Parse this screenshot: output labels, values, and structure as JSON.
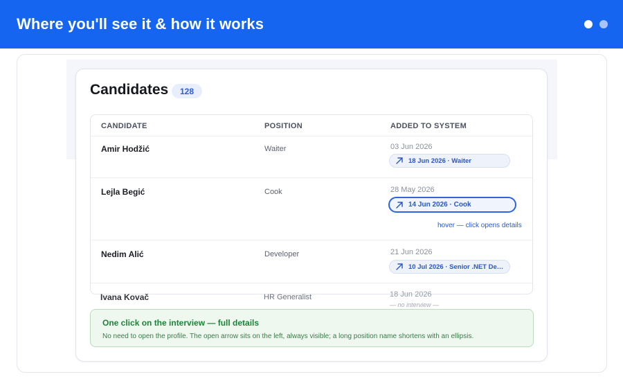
{
  "header": {
    "title": "Where you'll see it & how it works",
    "pager": {
      "count": 2,
      "active_index": 0
    }
  },
  "page": {
    "title": "Candidates",
    "count_badge": "128"
  },
  "table": {
    "columns": [
      "CANDIDATE",
      "POSITION",
      "ADDED TO SYSTEM"
    ],
    "rows": [
      {
        "name": "Amir Hodžić",
        "position": "Waiter",
        "added": "03 Jun 2026",
        "interview": "18 Jun 2026 · Waiter",
        "state": "normal"
      },
      {
        "name": "Lejla Begić",
        "position": "Cook",
        "added": "28 May 2026",
        "interview": "14 Jun 2026 · Cook",
        "state": "hovered",
        "hover_note": "hover — click opens details"
      },
      {
        "name": "Nedim Alić",
        "position": "Developer",
        "added": "21 Jun 2026",
        "interview": "10 Jul 2026 · Senior .NET Devel...",
        "state": "truncated"
      },
      {
        "name": "Ivana Kovač",
        "position": "HR Generalist",
        "added": "18 Jun 2026",
        "interview": "— no interview —",
        "state": "none"
      }
    ]
  },
  "info": {
    "title": "One click on the interview — full details",
    "text": "No need to open the profile. The open arrow sits on the left, always visible; a long position name shortens with an ellipsis."
  },
  "icons": {
    "chip": "arrow-up-right-icon"
  },
  "colors": {
    "header_bg": "#1565f0",
    "accent": "#2d63dc",
    "badge_bg": "#e8eefc",
    "info_bg": "#eef8ef",
    "info_title": "#20803a"
  }
}
